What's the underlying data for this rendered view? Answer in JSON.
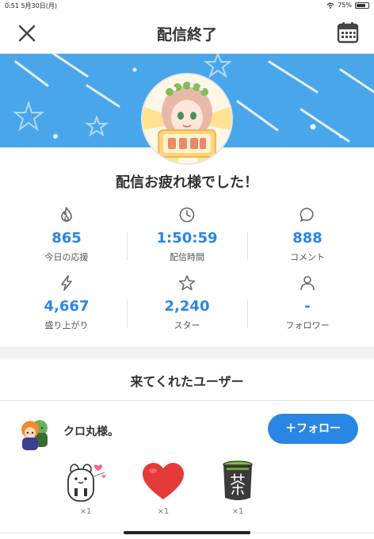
{
  "status_bar": {
    "time": "0:51",
    "date": "5月30日(月)",
    "battery": "75%",
    "battery_level": 0.75
  },
  "nav": {
    "title": "配信終了",
    "close_icon": "close-icon",
    "calendar_icon": "calendar-icon"
  },
  "banner": {
    "colors": {
      "background": "#4aa6ea",
      "accent": "#2a86e4"
    }
  },
  "message": "配信お疲れ様でした！",
  "stats": [
    {
      "icon": "flame-icon",
      "value": "865",
      "label": "今日の応援"
    },
    {
      "icon": "clock-icon",
      "value": "1:50:59",
      "label": "配信時間"
    },
    {
      "icon": "comment-icon",
      "value": "888",
      "label": "コメント"
    },
    {
      "icon": "lightning-icon",
      "value": "4,667",
      "label": "盛り上がり"
    },
    {
      "icon": "star-icon",
      "value": "2,240",
      "label": "スター"
    },
    {
      "icon": "person-icon",
      "value": "-",
      "label": "フォロワー"
    }
  ],
  "visitors": {
    "title": "来てくれたユーザー",
    "user": {
      "name": "クロ丸様。",
      "follow_label": "＋フォロー"
    },
    "gifts": [
      {
        "icon": "rabbit-gift-icon",
        "count": "×1"
      },
      {
        "icon": "heart-gift-icon",
        "count": "×1"
      },
      {
        "icon": "tea-gift-icon",
        "count": "×1"
      }
    ]
  }
}
